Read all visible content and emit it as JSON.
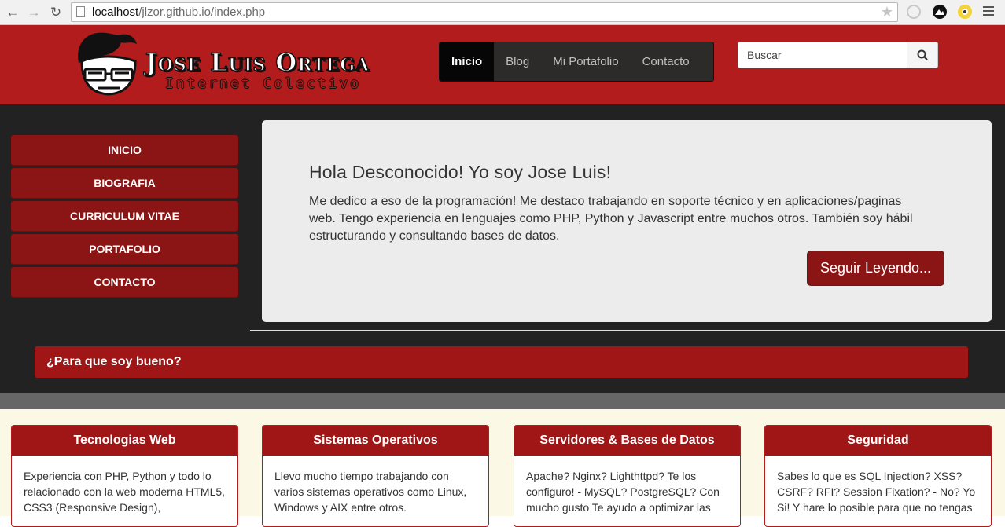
{
  "browser": {
    "url_host": "localhost",
    "url_rest": "/jlzor.github.io/index.php"
  },
  "site": {
    "logo_name": "Jose Luis Ortega",
    "logo_subtitle": "Internet Colectivo",
    "topnav": [
      "Inicio",
      "Blog",
      "Mi Portafolio",
      "Contacto"
    ],
    "search_placeholder": "Buscar"
  },
  "sidebar": {
    "items": [
      "INICIO",
      "BIOGRAFIA",
      "CURRICULUM VITAE",
      "PORTAFOLIO",
      "CONTACTO"
    ]
  },
  "hero": {
    "title": "Hola Desconocido! Yo soy Jose Luis!",
    "text": "Me dedico a eso de la programación! Me destaco trabajando en soporte técnico y en aplicaciones/paginas web. Tengo experiencia en lenguajes como PHP, Python y Javascript entre muchos otros. También soy hábil estructurando y consultando bases de datos.",
    "cta": "Seguir Leyendo..."
  },
  "banner": {
    "title": "¿Para que soy bueno?"
  },
  "cards": [
    {
      "title": "Tecnologias Web",
      "text": "Experiencia con PHP, Python y todo lo relacionado con la web moderna HTML5, CSS3 (Responsive Design),"
    },
    {
      "title": "Sistemas Operativos",
      "text": "Llevo mucho tiempo trabajando con varios sistemas operativos como Linux, Windows y AIX entre otros."
    },
    {
      "title": "Servidores & Bases de Datos",
      "text": "Apache? Nginx? Lighthttpd? Te los configuro! - MySQL? PostgreSQL? Con mucho gusto Te ayudo a optimizar las"
    },
    {
      "title": "Seguridad",
      "text": "Sabes lo que es SQL Injection? XSS? CSRF? RFI? Session Fixation? - No? Yo Si! Y hare lo posible para que no tengas"
    }
  ],
  "colors": {
    "brand_red": "#b21c1c",
    "button_red": "#8b1515",
    "dark_bg": "#222222",
    "cream_bg": "#fbf8e6"
  }
}
